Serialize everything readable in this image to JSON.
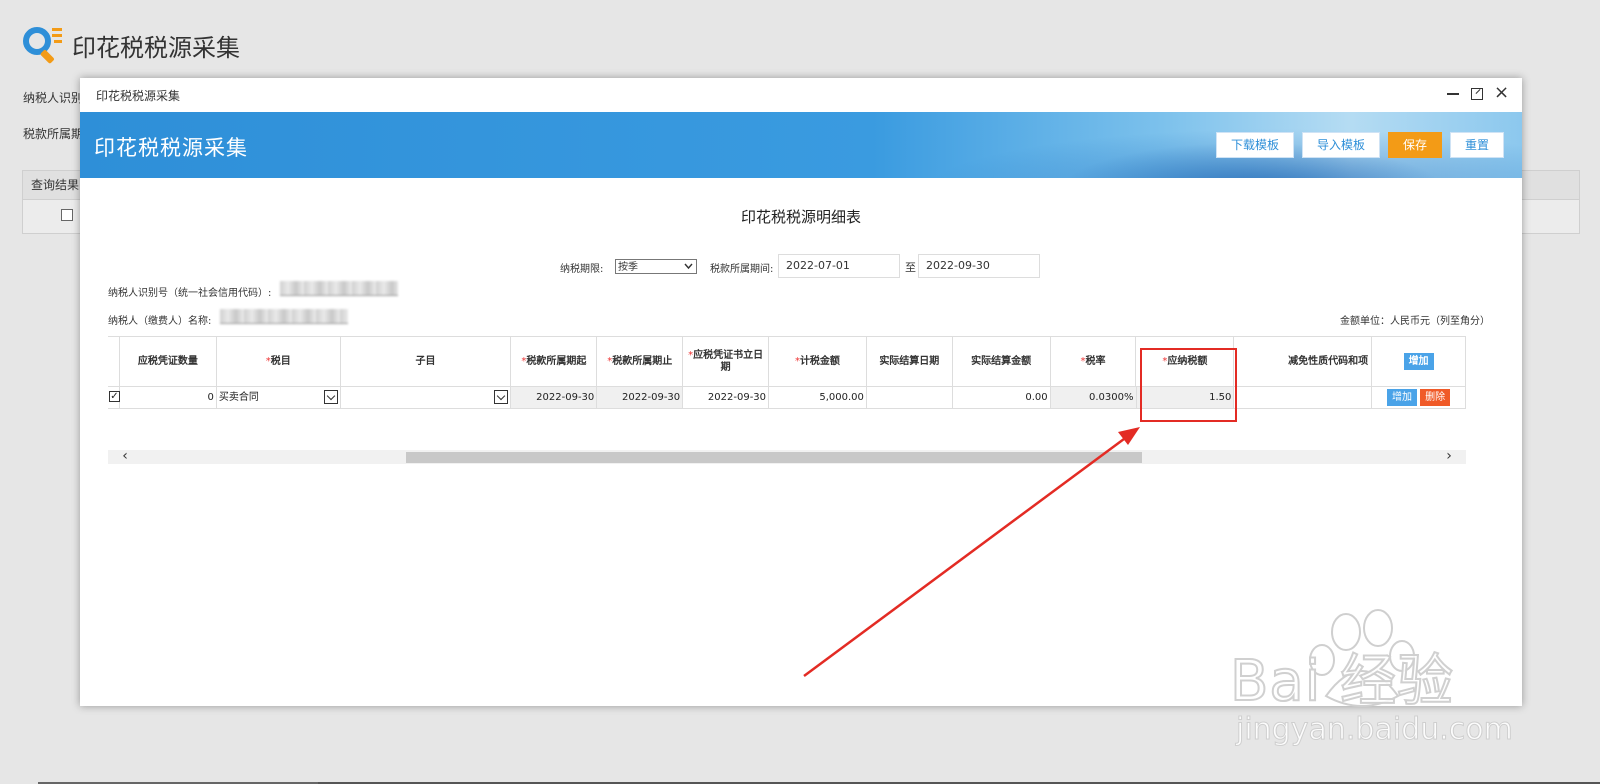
{
  "page": {
    "title": "印花税税源采集",
    "label_taxpayer_id": "纳税人识别",
    "label_tax_period": "税款所属期",
    "query_result": "查询结果"
  },
  "modal": {
    "window_title": "印花税税源采集",
    "banner_title": "印花税税源采集",
    "buttons": {
      "download_template": "下载模板",
      "import_template": "导入模板",
      "save": "保存",
      "reset": "重置"
    },
    "sheet_title": "印花税税源明细表",
    "period_label": "纳税期限:",
    "period_value": "按季",
    "tax_period_label": "税款所属期间:",
    "date_from": "2022-07-01",
    "to_label": "至",
    "date_to": "2022-09-30",
    "taxpayer_id_label": "纳税人识别号（统一社会信用代码）:",
    "taxpayer_name_label": "纳税人（缴费人）名称:",
    "amount_unit": "金额单位：人民币元（列至角分）"
  },
  "table": {
    "headers": {
      "voucher_qty": "应税凭证数量",
      "tax_item": "税目",
      "sub_item": "子目",
      "period_start": "税款所属期起",
      "period_end": "税款所属期止",
      "voucher_date": "应税凭证书立日期",
      "tax_base": "计税金额",
      "settle_date": "实际结算日期",
      "settle_amount": "实际结算金额",
      "tax_rate": "税率",
      "tax_payable": "应纳税额",
      "exemption_code": "减免性质代码和项",
      "add": "增加"
    },
    "row": {
      "checked": "✓",
      "voucher_qty": "0",
      "tax_item": "买卖合同",
      "sub_item": "",
      "period_start": "2022-09-30",
      "period_end": "2022-09-30",
      "voucher_date": "2022-09-30",
      "tax_base": "5,000.00",
      "settle_date": "",
      "settle_amount": "0.00",
      "tax_rate": "0.0300%",
      "tax_payable": "1.50",
      "exemption_code": "",
      "add": "增加",
      "delete": "删除"
    }
  },
  "scrollbar": {
    "left": "‹",
    "right": "›"
  },
  "watermark": {
    "brand": "Bai 经验",
    "url": "jingyan.baidu.com"
  },
  "colors": {
    "accent": "#2e8fd8",
    "save": "#f39b16",
    "delete": "#f05a28",
    "highlight": "#e32b24"
  }
}
